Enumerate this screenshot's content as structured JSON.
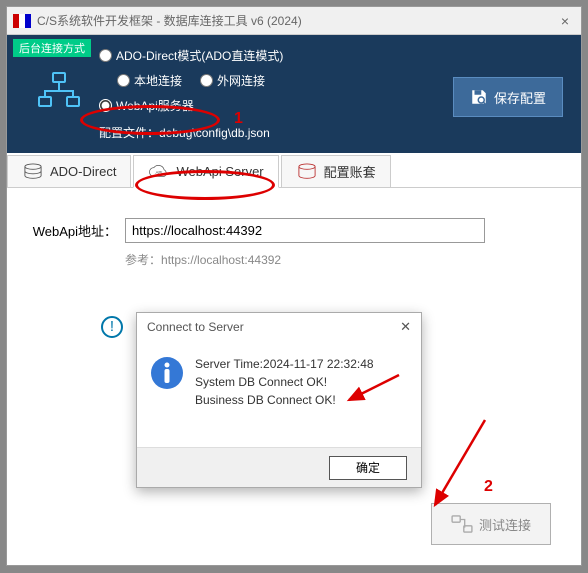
{
  "window": {
    "title": "C/S系统软件开发框架 - 数据库连接工具 v6 (2024)"
  },
  "topsection": {
    "tag": "后台连接方式",
    "radio_ado": "ADO-Direct模式(ADO直连模式)",
    "radio_local": "本地连接",
    "radio_external": "外网连接",
    "radio_webapi": "WebApi服务器",
    "config_prefix": "配置文件：",
    "config_path": "debug\\config\\db.json",
    "save_btn": "保存配置"
  },
  "tabs": {
    "ado": "ADO-Direct",
    "webapi": "WebApi Server",
    "accounts": "配置账套"
  },
  "webapi_panel": {
    "label": "WebApi地址：",
    "value": "https://localhost:44392",
    "ref_prefix": "参考：",
    "ref": "https://localhost:44392",
    "test_btn": "测试连接"
  },
  "dialog": {
    "title": "Connect to Server",
    "line1": "Server Time:2024-11-17 22:32:48",
    "line2": "System DB Connect OK!",
    "line3": "Business DB Connect OK!",
    "ok": "确定"
  },
  "annotations": {
    "one": "1",
    "two": "2"
  }
}
